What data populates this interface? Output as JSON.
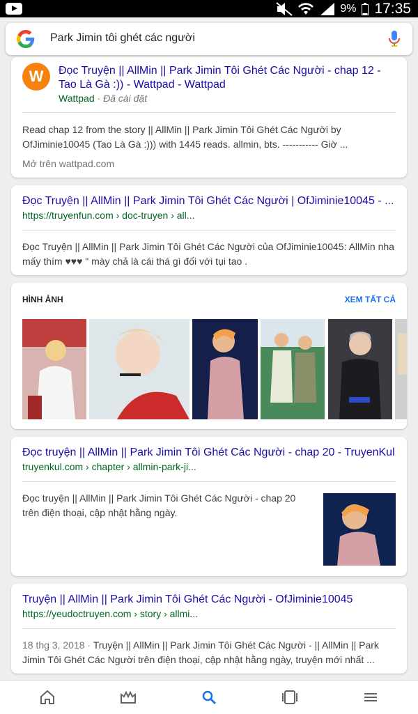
{
  "status_bar": {
    "battery": "9%",
    "time": "17:35"
  },
  "search": {
    "query": "Park Jimin tôi ghét các người"
  },
  "results": [
    {
      "title": "Đọc Truyện || AllMin || Park Jimin Tôi Ghét Các Người - chap 12 - Tao Là Gà :)) - Wattpad - Wattpad",
      "app_name": "Wattpad",
      "app_status": "· Đã cài đặt",
      "snippet": "Read chap 12 from the story || AllMin || Park Jimin Tôi Ghét Các Người by OfJiminie10045 (Tao Là Gà :))) with 1445 reads. allmin, bts. ----------- Giờ ...",
      "open_in": "Mở trên wattpad.com",
      "icon_letter": "W"
    },
    {
      "title": "Đọc Truyện || AllMin || Park Jimin Tôi Ghét Các Người | OfJiminie10045 - ...",
      "url": "https://truyenfun.com › doc-truyen › all...",
      "snippet": "Đọc Truyện || AllMin || Park Jimin Tôi Ghét Các Người của OfJiminie10045: AllMin nha mấy thím ♥♥♥ \" mày chả là cái thá gì đối với tụi tao ."
    },
    {
      "title": "Đọc truyện || AllMin || Park Jimin Tôi Ghét Các Người - chap 20 - TruyenKul",
      "url": "truyenkul.com › chapter › allmin-park-ji...",
      "snippet": "Đọc truyện || AllMin || Park Jimin Tôi Ghét Các Người - chap 20 trên điện thoại, cập nhật hằng ngày."
    },
    {
      "title": "Truyện || AllMin || Park Jimin Tôi Ghét Các Người - OfJiminie10045",
      "url": "https://yeudoctruyen.com › story › allmi...",
      "date": "18 thg 3, 2018 ·",
      "snippet": "Truyện || AllMin || Park Jimin Tôi Ghét Các Người - || AllMin || Park Jimin Tôi Ghét Các Người trên điện thoại, cập nhật hằng ngày, truyện mới nhất ..."
    }
  ],
  "images": {
    "heading": "HÌNH ẢNH",
    "see_all": "XEM TẤT CẢ",
    "accent": "#1a73e8"
  },
  "colors": {
    "link": "#1a0dab",
    "url": "#006621",
    "accent": "#1a73e8"
  },
  "bottom_nav": [
    {
      "icon": "home-icon"
    },
    {
      "icon": "updates-icon"
    },
    {
      "icon": "search-icon"
    },
    {
      "icon": "tabs-icon"
    },
    {
      "icon": "menu-icon"
    }
  ]
}
